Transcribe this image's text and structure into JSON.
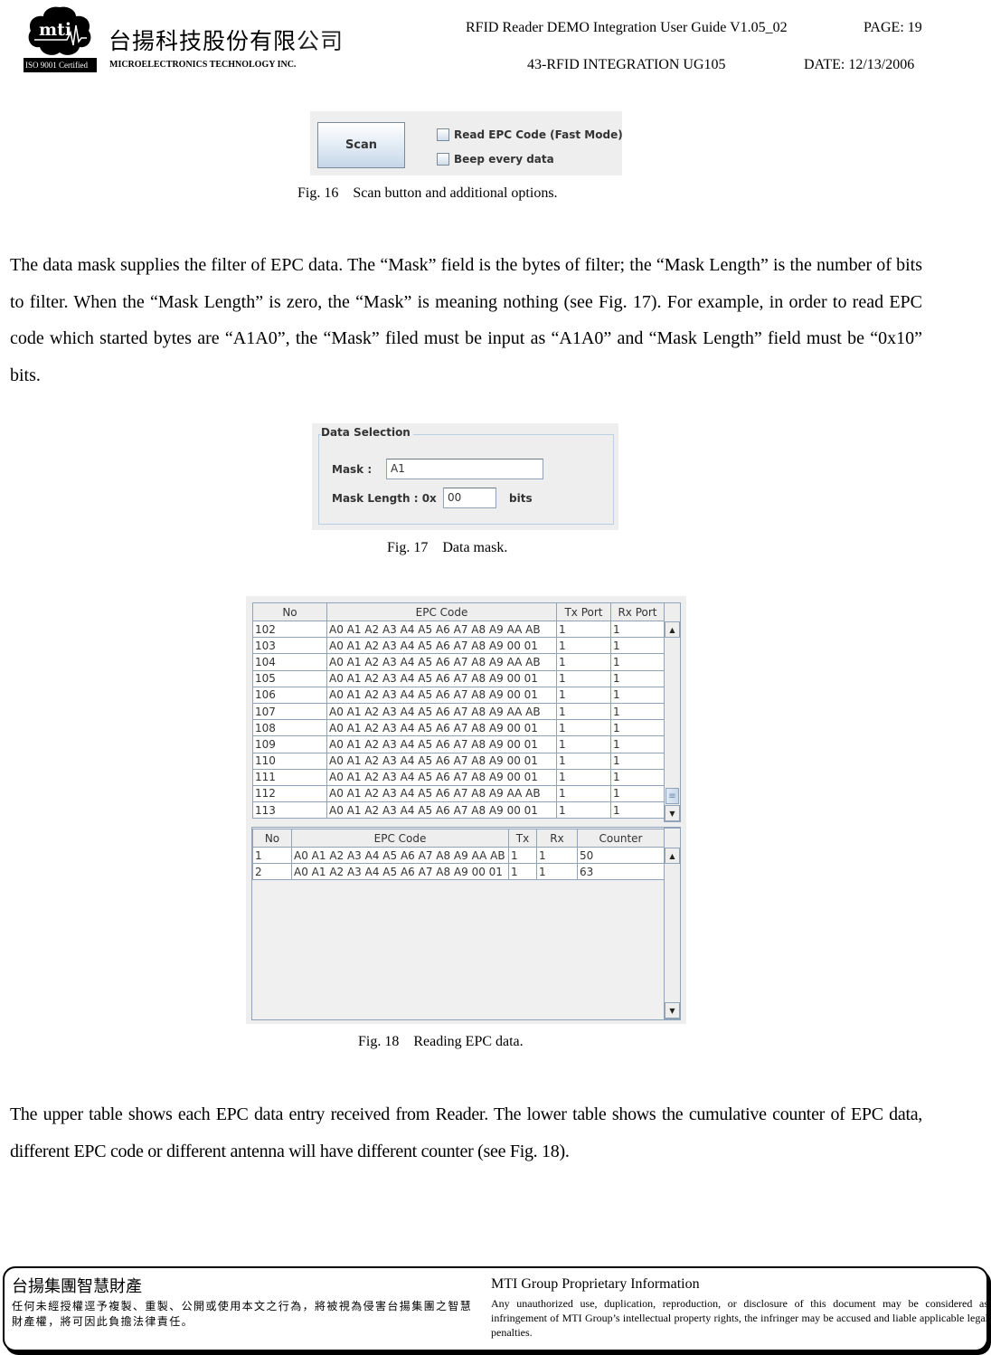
{
  "header": {
    "logo_text": "mti",
    "iso_badge": "ISO 9001 Certified",
    "company_zh_bold": "台揚科技股份有限",
    "company_zh_light": "公司",
    "company_en": "MICROELECTRONICS TECHNOLOGY INC.",
    "doc_title": "RFID Reader DEMO Integration User Guide V1.05_02",
    "page": "PAGE: 19",
    "doc_number": "43-RFID INTEGRATION UG105",
    "date": "DATE: 12/13/2006"
  },
  "fig16": {
    "scan_button": "Scan",
    "options": [
      {
        "label": "Read EPC Code (Fast Mode)",
        "checked": false
      },
      {
        "label": "Beep every data",
        "checked": false
      }
    ],
    "caption": "Fig. 16    Scan button and additional options."
  },
  "paragraph1": "The data mask supplies the filter of EPC data.   The “Mask” field is the bytes of filter; the “Mask Length” is the number of bits to filter.   When the “Mask Length” is zero, the “Mask” is meaning nothing (see Fig. 17).   For example, in order to read EPC code which started bytes are “A1A0”, the “Mask” filed must be input as “A1A0” and “Mask Length” field must be “0x10” bits.",
  "fig17": {
    "group_title": "Data Selection",
    "mask_label": "Mask :",
    "mask_value": "A1",
    "mask_length_label": "Mask Length : 0x",
    "mask_length_value": "00",
    "bits_label": "bits",
    "caption": "Fig. 17    Data mask."
  },
  "fig18": {
    "upper_table": {
      "columns": [
        "No",
        "EPC Code",
        "Tx Port",
        "Rx Port"
      ],
      "rows": [
        [
          "102",
          "A0 A1 A2 A3 A4 A5 A6 A7 A8 A9 AA AB",
          "1",
          "1"
        ],
        [
          "103",
          "A0 A1 A2 A3 A4 A5 A6 A7 A8 A9 00 01",
          "1",
          "1"
        ],
        [
          "104",
          "A0 A1 A2 A3 A4 A5 A6 A7 A8 A9 AA AB",
          "1",
          "1"
        ],
        [
          "105",
          "A0 A1 A2 A3 A4 A5 A6 A7 A8 A9 00 01",
          "1",
          "1"
        ],
        [
          "106",
          "A0 A1 A2 A3 A4 A5 A6 A7 A8 A9 00 01",
          "1",
          "1"
        ],
        [
          "107",
          "A0 A1 A2 A3 A4 A5 A6 A7 A8 A9 AA AB",
          "1",
          "1"
        ],
        [
          "108",
          "A0 A1 A2 A3 A4 A5 A6 A7 A8 A9 00 01",
          "1",
          "1"
        ],
        [
          "109",
          "A0 A1 A2 A3 A4 A5 A6 A7 A8 A9 00 01",
          "1",
          "1"
        ],
        [
          "110",
          "A0 A1 A2 A3 A4 A5 A6 A7 A8 A9 00 01",
          "1",
          "1"
        ],
        [
          "111",
          "A0 A1 A2 A3 A4 A5 A6 A7 A8 A9 00 01",
          "1",
          "1"
        ],
        [
          "112",
          "A0 A1 A2 A3 A4 A5 A6 A7 A8 A9 AA AB",
          "1",
          "1"
        ],
        [
          "113",
          "A0 A1 A2 A3 A4 A5 A6 A7 A8 A9 00 01",
          "1",
          "1"
        ]
      ]
    },
    "lower_table": {
      "columns": [
        "No",
        "EPC Code",
        "Tx",
        "Rx",
        "Counter"
      ],
      "rows": [
        [
          "1",
          "A0 A1 A2 A3 A4 A5 A6 A7 A8 A9 AA AB",
          "1",
          "1",
          "50"
        ],
        [
          "2",
          "A0 A1 A2 A3 A4 A5 A6 A7 A8 A9 00 01",
          "1",
          "1",
          "63"
        ]
      ]
    },
    "scroll_up_icon": "▲",
    "scroll_down_icon": "▼",
    "scroll_grip_icon": "≡",
    "caption": "Fig. 18    Reading EPC data."
  },
  "paragraph2": "The upper table shows each EPC data entry received from Reader. The lower table shows the cumulative counter of EPC data, different EPC code or different antenna will have different counter (see Fig. 18).",
  "footer": {
    "zh_title": "台揚集團智慧財產",
    "zh_body": "任何未經授權逕予複製、重製、公開或使用本文之行為，將被視為侵害台揚集團之智慧財產權，將可因此負擔法律責任。",
    "en_title": "MTI Group Proprietary Information",
    "en_body": "Any unauthorized use, duplication, reproduction, or disclosure of this document may be considered as infringement of MTI Group’s intellectual property rights, the infringer may be accused and liable applicable legal penalties."
  }
}
